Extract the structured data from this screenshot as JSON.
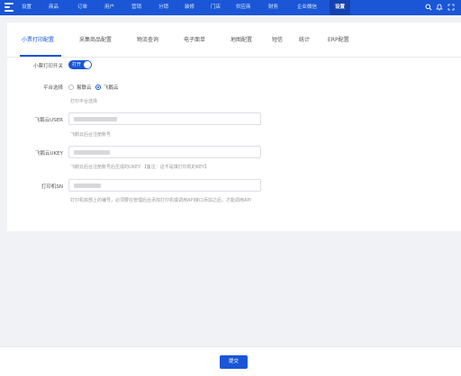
{
  "topbar": {
    "nav": [
      "设置",
      "商品",
      "订单",
      "用户",
      "营销",
      "分销",
      "装修",
      "门店",
      "供应商",
      "财务",
      "企业微信",
      "设置"
    ],
    "active_index": 11,
    "icons": [
      "search-icon",
      "bell-icon",
      "fullscreen-icon"
    ]
  },
  "tabs": [
    "小票打印配置",
    "采集商品配置",
    "物流查询",
    "电子面单",
    "地图配置",
    "短信",
    "统计",
    "ERP配置"
  ],
  "form": {
    "switch_label": "小票打印开关",
    "switch_text": "打开",
    "platform_label": "平台选择",
    "platform_options": [
      "易联云",
      "飞鹅云"
    ],
    "platform_selected": 1,
    "platform_hint": "打印平台选择",
    "user_label": "飞鹅云USER",
    "user_hint": "飞鹅云后台注册账号",
    "ukey_label": "飞鹅云UKEY",
    "ukey_hint": "飞鹅云后台注册账号后生成的UKEY 【备注：这不是填打印机的KEY】",
    "sn_label": "打印机SN",
    "sn_hint": "打印机底部上的编号，必须要在管理后台添加打印机或调用API接口添加之后，才能调用API"
  },
  "footer": {
    "submit_label": "提交"
  },
  "colors": {
    "primary": "#1a56d6",
    "topbar": "#1a56d6"
  }
}
